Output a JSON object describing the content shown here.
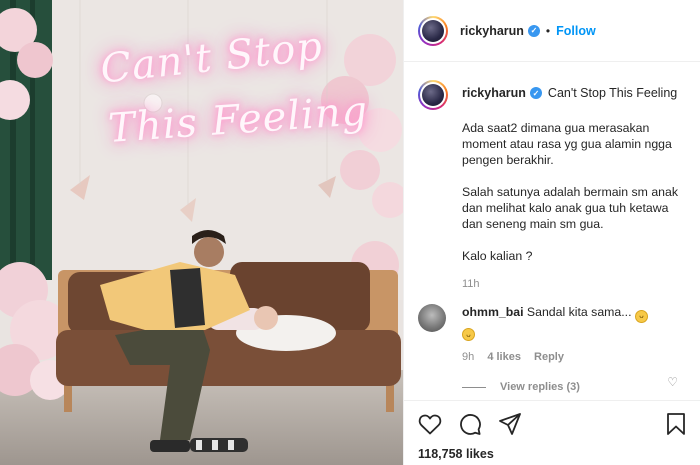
{
  "photo": {
    "neon_line1": "Can't Stop",
    "neon_line2": "This Feeling"
  },
  "post": {
    "username": "rickyharun",
    "follow_label": "Follow",
    "dot": "•",
    "caption_title": "Can't Stop This Feeling",
    "caption_paragraphs": [
      "Ada saat2 dimana gua merasakan moment atau rasa yg gua alamin ngga pengen berakhir.",
      "Salah satunya adalah bermain sm anak dan melihat kalo anak gua tuh ketawa dan seneng main sm gua.",
      "Kalo kalian ?"
    ],
    "caption_time": "11h"
  },
  "comment": {
    "username": "ohmm_bai",
    "text": "Sandal kita sama...",
    "time": "9h",
    "likes": "4 likes",
    "reply_label": "Reply",
    "view_replies": "View replies (3)"
  },
  "actions": {
    "likes_total": "118,758 likes"
  },
  "icons": [
    "verified-badge",
    "heart-icon",
    "comment-icon",
    "share-icon",
    "bookmark-icon",
    "grin-emoji"
  ],
  "colors": {
    "accent": "#0095f6",
    "verified": "#3897f0",
    "muted": "#8e8e8e",
    "text": "#262626"
  }
}
